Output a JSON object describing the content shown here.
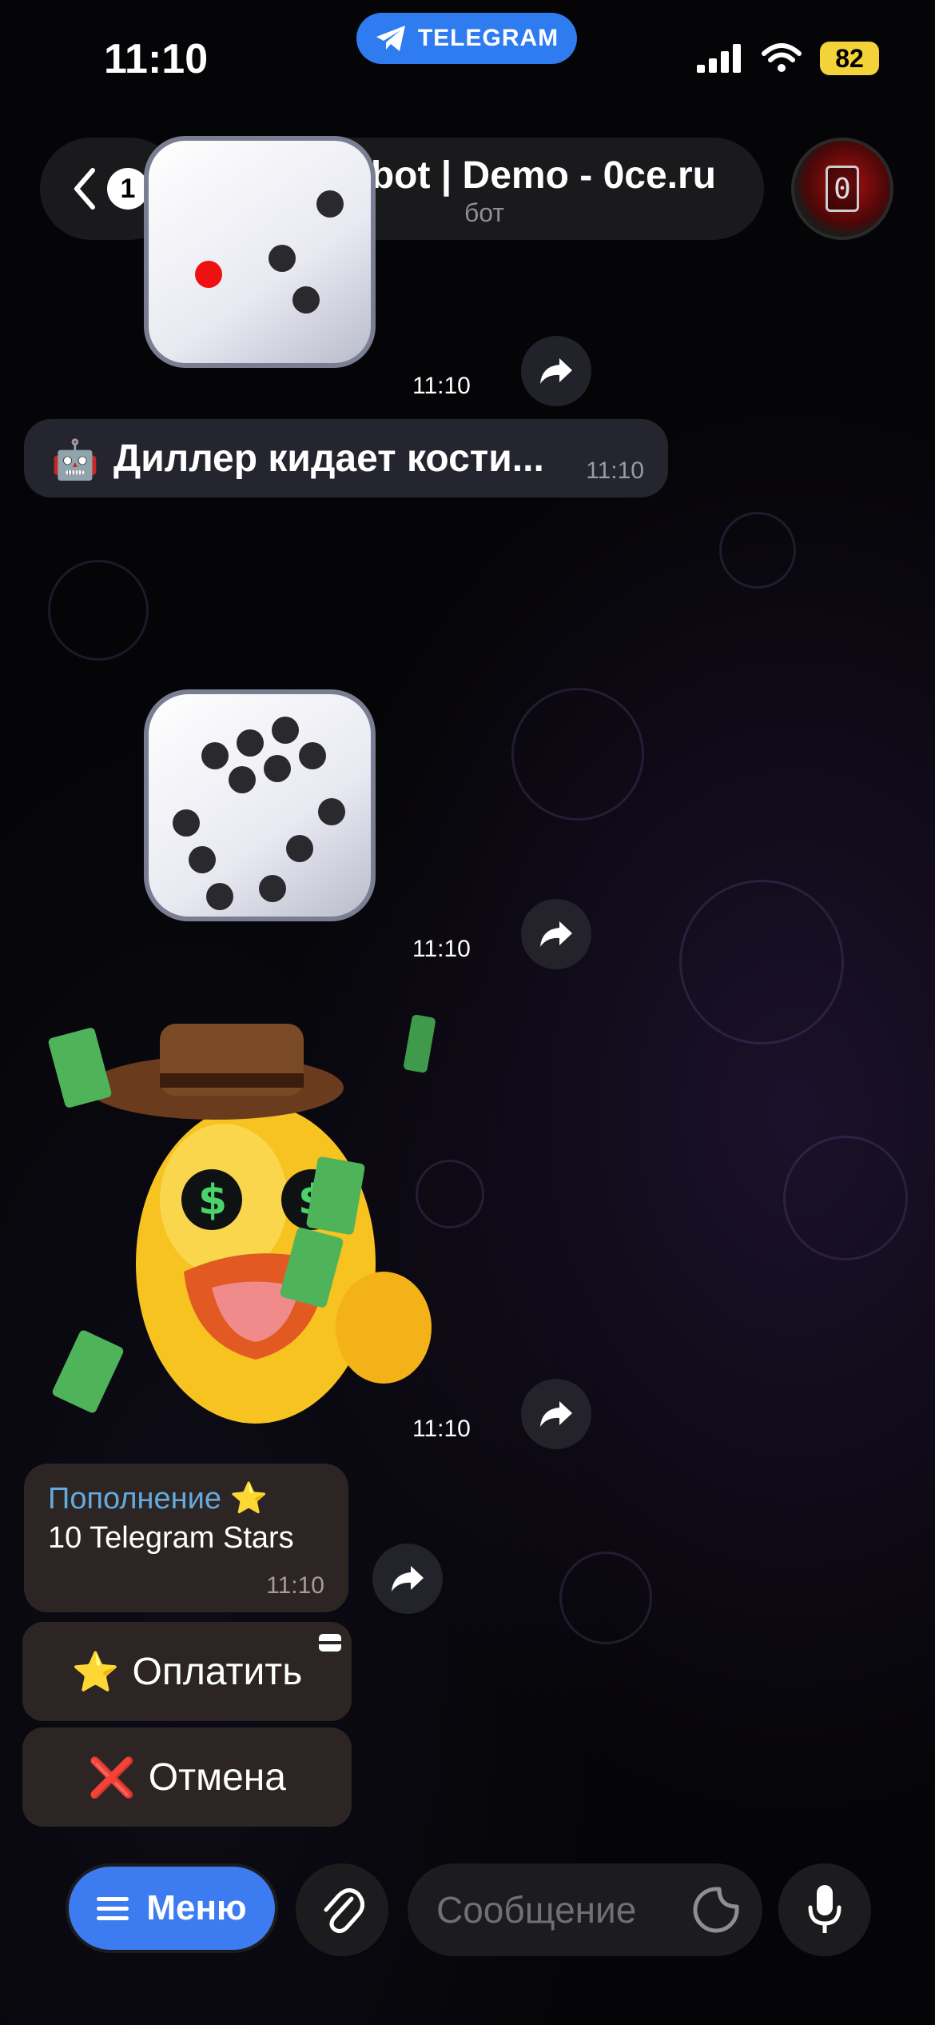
{
  "status_bar": {
    "time": "11:10",
    "app_label": "TELEGRAM",
    "battery": "82"
  },
  "header": {
    "back_badge": "1",
    "title": "🎰Casbot | Demo - 0ce.ru",
    "subtitle": "бот",
    "avatar_text": "0"
  },
  "messages": {
    "dice1_time": "11:10",
    "dealer_icon": "🤖",
    "dealer_text": "Диллер кидает кости...",
    "dealer_time": "11:10",
    "dice2_time": "11:10",
    "sticker_time": "11:10"
  },
  "invoice": {
    "title": "Пополнение ⭐️",
    "description": "10 Telegram Stars",
    "time": "11:10"
  },
  "keyboard": {
    "pay_icon": "⭐️",
    "pay_label": "Оплатить",
    "cancel_icon": "❌",
    "cancel_label": "Отмена"
  },
  "input_bar": {
    "menu_label": "Меню",
    "message_placeholder": "Сообщение"
  },
  "colors": {
    "accent": "#3d7cf0",
    "link": "#64aadf",
    "bubble": "#2c2524"
  }
}
